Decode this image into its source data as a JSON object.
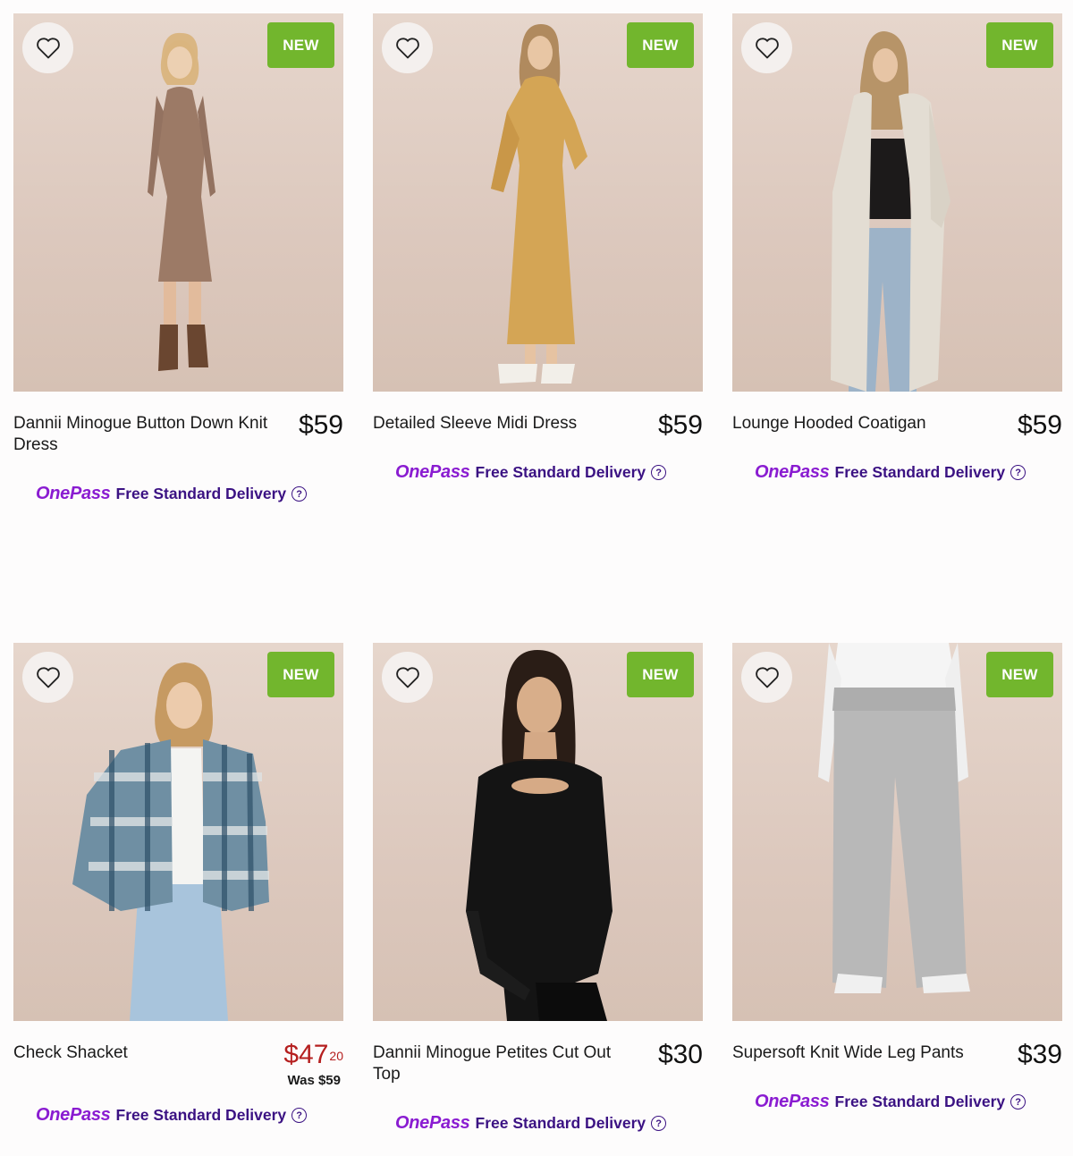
{
  "theme": {
    "new_badge_color": "#72b62d",
    "sale_price_color": "#b51f1f",
    "onepass_brand_color": "#8a1cd1",
    "delivery_text_color": "#3b1283"
  },
  "products": [
    {
      "title": "Dannii Minogue Button Down Knit Dress",
      "badge": "NEW",
      "price": "$59",
      "garment_color": "#9c7a66",
      "delivery": {
        "brand": "OnePass",
        "text": "Free Standard Delivery",
        "help": "?"
      }
    },
    {
      "title": "Detailed Sleeve Midi Dress",
      "badge": "NEW",
      "price": "$59",
      "garment_color": "#d4a555",
      "delivery": {
        "brand": "OnePass",
        "text": "Free Standard Delivery",
        "help": "?"
      }
    },
    {
      "title": "Lounge Hooded Coatigan",
      "badge": "NEW",
      "price": "$59",
      "garment_color": "#e3ddd3",
      "delivery": {
        "brand": "OnePass",
        "text": "Free Standard Delivery",
        "help": "?"
      }
    },
    {
      "title": "Check Shacket",
      "badge": "NEW",
      "price_dollars": "$47",
      "price_cents": "20",
      "was_price": "Was $59",
      "garment_color": "#6f8fa3",
      "delivery": {
        "brand": "OnePass",
        "text": "Free Standard Delivery",
        "help": "?"
      }
    },
    {
      "title": "Dannii Minogue Petites Cut Out Top",
      "badge": "NEW",
      "price": "$30",
      "garment_color": "#141414",
      "delivery": {
        "brand": "OnePass",
        "text": "Free Standard Delivery",
        "help": "?"
      }
    },
    {
      "title": "Supersoft Knit Wide Leg Pants",
      "badge": "NEW",
      "price": "$39",
      "garment_color": "#b8b8b8",
      "delivery": {
        "brand": "OnePass",
        "text": "Free Standard Delivery",
        "help": "?"
      }
    }
  ]
}
